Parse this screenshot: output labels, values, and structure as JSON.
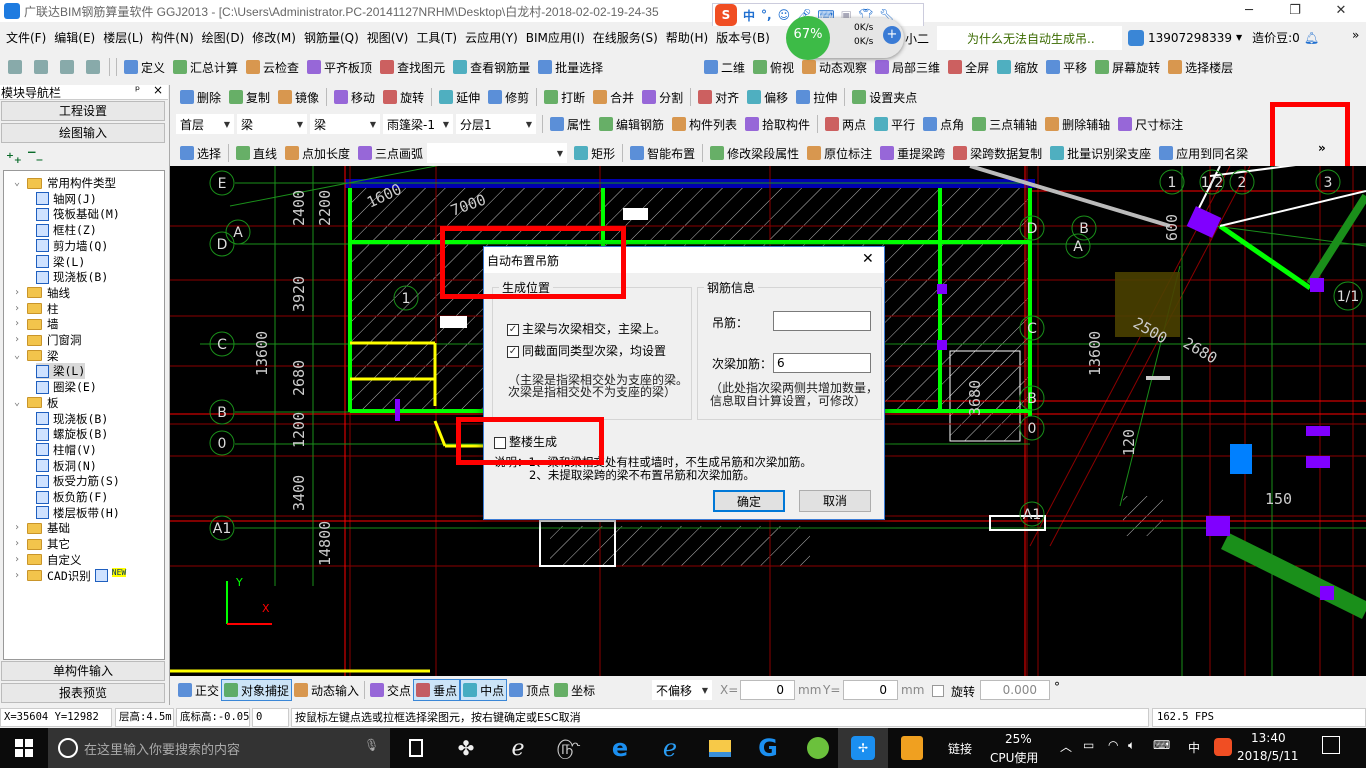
{
  "window": {
    "title": "广联达BIM钢筋算量软件 GGJ2013 - [C:\\Users\\Administrator.PC-20141127NRHM\\Desktop\\白龙村-2018-02-02-19-24-35",
    "minimize": "─",
    "restore": "❐",
    "close": "✕"
  },
  "ime": {
    "logo": "S",
    "mode": "中",
    "punct": "°,"
  },
  "netwidget": {
    "percent": "67%",
    "up": "0K/s",
    "down": "0K/s"
  },
  "menu": [
    "文件(F)",
    "编辑(E)",
    "楼层(L)",
    "构件(N)",
    "绘图(D)",
    "修改(M)",
    "钢筋量(Q)",
    "视图(V)",
    "工具(T)",
    "云应用(Y)",
    "BIM应用(I)",
    "在线服务(S)",
    "帮助(H)",
    "版本号(B)"
  ],
  "menu_extra": {
    "xiaoer": "小二",
    "question": "为什么无法自动生成吊..",
    "user": "13907298339",
    "beans": "造价豆:0",
    "more": "»"
  },
  "toolbar1": [
    "定义",
    "汇总计算",
    "云检查",
    "平齐板顶",
    "查找图元",
    "查看钢筋量",
    "批量选择"
  ],
  "toolbar1b": [
    "二维",
    "俯视",
    "动态观察",
    "局部三维",
    "全屏",
    "缩放",
    "平移",
    "屏幕旋转",
    "选择楼层"
  ],
  "toolbar2": [
    "删除",
    "复制",
    "镜像",
    "移动",
    "旋转",
    "延伸",
    "修剪",
    "打断",
    "合并",
    "分割",
    "对齐",
    "偏移",
    "拉伸",
    "设置夹点"
  ],
  "toolbar3_selects": [
    "首层",
    "梁",
    "梁",
    "雨篷梁-1",
    "分层1"
  ],
  "toolbar3": [
    "属性",
    "编辑钢筋",
    "构件列表",
    "拾取构件",
    "两点",
    "平行",
    "点角",
    "三点辅轴",
    "删除辅轴",
    "尺寸标注"
  ],
  "toolbar4": [
    "选择",
    "直线",
    "点加长度",
    "三点画弧",
    "",
    "矩形",
    "智能布置",
    "修改梁段属性",
    "原位标注",
    "重提梁跨",
    "梁跨数据复制",
    "批量识别梁支座",
    "应用到同名梁"
  ],
  "toolbar_overflow": "»",
  "nav": {
    "header": "模块导航栏",
    "pin": "ᵖ",
    "close": "×",
    "project_settings": "工程设置",
    "drawing_input": "绘图输入",
    "single_input": "单构件输入",
    "report_preview": "报表预览",
    "tree": [
      {
        "label": "常用构件类型",
        "type": "folder",
        "open": true,
        "level": 0
      },
      {
        "label": "轴网(J)",
        "type": "leaf",
        "level": 1
      },
      {
        "label": "筏板基础(M)",
        "type": "leaf",
        "level": 1
      },
      {
        "label": "框柱(Z)",
        "type": "leaf",
        "level": 1
      },
      {
        "label": "剪力墙(Q)",
        "type": "leaf",
        "level": 1
      },
      {
        "label": "梁(L)",
        "type": "leaf",
        "level": 1
      },
      {
        "label": "现浇板(B)",
        "type": "leaf",
        "level": 1
      },
      {
        "label": "轴线",
        "type": "folder",
        "open": false,
        "level": 0
      },
      {
        "label": "柱",
        "type": "folder",
        "open": false,
        "level": 0
      },
      {
        "label": "墙",
        "type": "folder",
        "open": false,
        "level": 0
      },
      {
        "label": "门窗洞",
        "type": "folder",
        "open": false,
        "level": 0
      },
      {
        "label": "梁",
        "type": "folder",
        "open": true,
        "level": 0
      },
      {
        "label": "梁(L)",
        "type": "leaf",
        "level": 1,
        "selected": true
      },
      {
        "label": "圈梁(E)",
        "type": "leaf",
        "level": 1
      },
      {
        "label": "板",
        "type": "folder",
        "open": true,
        "level": 0
      },
      {
        "label": "现浇板(B)",
        "type": "leaf",
        "level": 1
      },
      {
        "label": "螺旋板(B)",
        "type": "leaf",
        "level": 1
      },
      {
        "label": "柱帽(V)",
        "type": "leaf",
        "level": 1
      },
      {
        "label": "板洞(N)",
        "type": "leaf",
        "level": 1
      },
      {
        "label": "板受力筋(S)",
        "type": "leaf",
        "level": 1
      },
      {
        "label": "板负筋(F)",
        "type": "leaf",
        "level": 1
      },
      {
        "label": "楼层板带(H)",
        "type": "leaf",
        "level": 1
      },
      {
        "label": "基础",
        "type": "folder",
        "open": false,
        "level": 0
      },
      {
        "label": "其它",
        "type": "folder",
        "open": false,
        "level": 0
      },
      {
        "label": "自定义",
        "type": "folder",
        "open": false,
        "level": 0
      },
      {
        "label": "CAD识别",
        "type": "folder",
        "open": false,
        "level": 0,
        "badge": "NEW"
      }
    ]
  },
  "canvas": {
    "axes_left": [
      "E",
      "D",
      "A",
      "C",
      "B",
      "0",
      "A1"
    ],
    "axes_top": [
      "1",
      "2",
      "3",
      "1/1",
      "1/2"
    ],
    "axes_right": [
      "D",
      "C",
      "B",
      "0",
      "A1",
      "A",
      "B"
    ],
    "dims": [
      "2400",
      "2200",
      "3920",
      "13600",
      "2680",
      "1200",
      "3400",
      "14800",
      "7000",
      "1600",
      "3680",
      "150",
      "600",
      "120",
      "2500",
      "2680"
    ],
    "ucs_y": "Y",
    "ucs_x": "X"
  },
  "dialog": {
    "title": "自动布置吊筋",
    "close": "✕",
    "position_group": "生成位置",
    "cb_main": {
      "label": "主梁与次梁相交，主梁上。",
      "checked": true
    },
    "cb_same": {
      "label": "同截面同类型次梁，均设置",
      "checked": true
    },
    "note1a": "（主梁是指梁相交处为支座的梁。",
    "note1b": "次梁是指相交处不为支座的梁）",
    "rebar_group": "钢筋信息",
    "hanger_label": "吊筋：",
    "hanger_value": "",
    "secondary_label": "次梁加筋：",
    "secondary_value": "6",
    "note2a": "（此处指次梁两侧共增加数量，",
    "note2b": "信息取自计算设置，可修改）",
    "whole_building": {
      "label": "整楼生成",
      "checked": false
    },
    "desc1": "说明：1、梁和梁相交处有柱或墙时，不生成吊筋和次梁加筋。",
    "desc2": "2、未提取梁跨的梁不布置吊筋和次梁加筋。",
    "ok": "确定",
    "cancel": "取消"
  },
  "snapbar": {
    "items": [
      "正交",
      "对象捕捉",
      "动态输入",
      "交点",
      "垂点",
      "中点",
      "顶点",
      "坐标"
    ],
    "active": [
      "对象捕捉",
      "垂点",
      "中点"
    ],
    "offset": "不偏移",
    "x_label": "X=",
    "x_value": "0",
    "mm1": "mm",
    "y_label": "Y=",
    "y_value": "0",
    "mm2": "mm",
    "rotate_label": "旋转",
    "rotate_value": "0.000",
    "deg": "°"
  },
  "status": {
    "coords": "X=35604 Y=12982",
    "floor_height": "层高:4.5m",
    "bottom_elev": "底标高:-0.05m",
    "zero": "0",
    "hint": "按鼠标左键点选或拉框选择梁图元，按右键确定或ESC取消",
    "fps": "162.5 FPS"
  },
  "taskbar": {
    "search_placeholder": "在这里输入你要搜索的内容",
    "link": "链接",
    "cpu_percent": "25%",
    "cpu_label": "CPU使用",
    "ime": "中",
    "time": "13:40",
    "date": "2018/5/11"
  },
  "colors": {
    "highlight_red": "#ff0000",
    "canvas_bg": "#000000",
    "beam_green": "#00ff00",
    "axis_green": "#1a8f1a",
    "grid_red": "#8b0000",
    "taskbar": "#0b0b0b"
  }
}
